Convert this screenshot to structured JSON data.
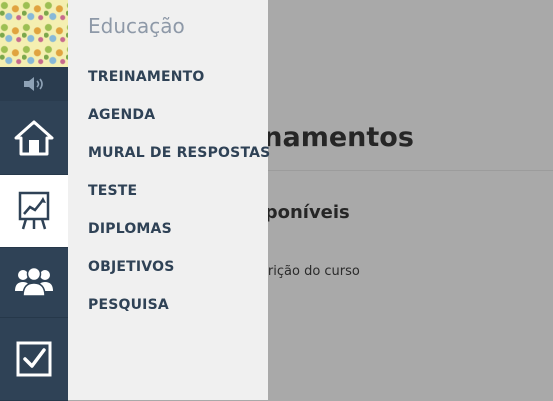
{
  "background_page": {
    "title": "inamentos",
    "subtitle": "sponíveis",
    "text": "scrição do curso"
  },
  "rail": {
    "items": [
      {
        "icon": "speaker-icon"
      },
      {
        "icon": "home-icon"
      },
      {
        "icon": "chart-board-icon",
        "active": true
      },
      {
        "icon": "people-icon"
      },
      {
        "icon": "checkbox-icon"
      }
    ],
    "colors": {
      "background": "#2f4256",
      "active_background": "#ffffff"
    }
  },
  "menu": {
    "title": "Educação",
    "items": [
      {
        "label": "TREINAMENTO"
      },
      {
        "label": "AGENDA"
      },
      {
        "label": "MURAL DE RESPOSTAS"
      },
      {
        "label": "TESTE"
      },
      {
        "label": "DIPLOMAS"
      },
      {
        "label": "OBJETIVOS"
      },
      {
        "label": "PESQUISA"
      }
    ],
    "colors": {
      "background": "#f0f0f0",
      "title": "#8e99a8",
      "item": "#2f4256"
    }
  }
}
